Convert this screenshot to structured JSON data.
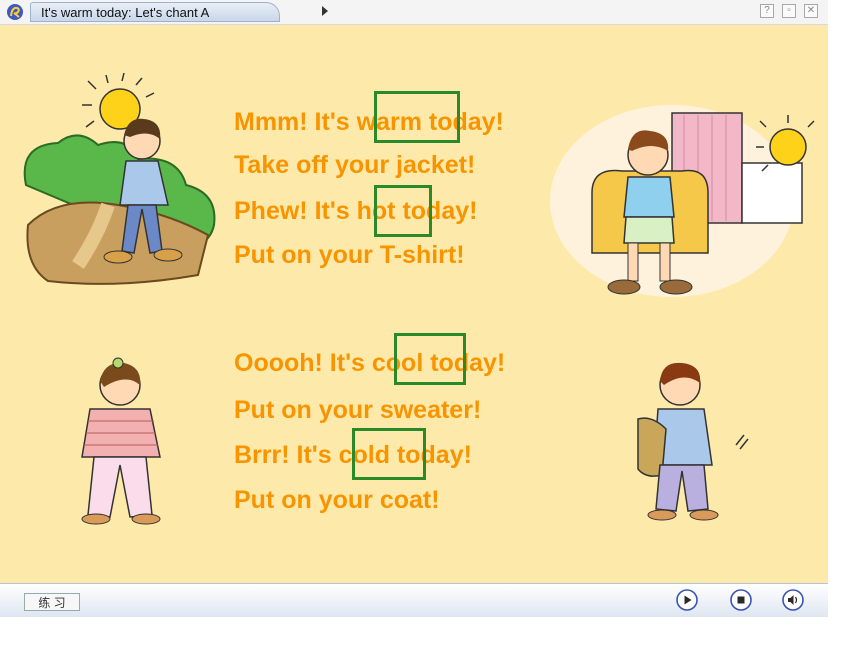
{
  "window": {
    "title": "It's warm today: Let's chant A",
    "help_label": "?",
    "restore_label": "▫",
    "close_label": "✕"
  },
  "chant": {
    "verse1": {
      "line1_a": "Mmm! It's ",
      "line1_word": "warm",
      "line1_b": " today!",
      "line2": "Take off your jacket!",
      "line3_a": "Phew! It's ",
      "line3_word": "hot",
      "line3_b": " today!",
      "line4": "Put on your T-shirt!"
    },
    "verse2": {
      "line1_a": "Ooooh! It's ",
      "line1_word": "cool",
      "line1_b": " today!",
      "line2": "Put on your sweater!",
      "line3_a": "Brrr! It's ",
      "line3_word": "cold",
      "line3_b": " today!",
      "line4": "Put on your coat!"
    }
  },
  "toolbar": {
    "practice_label": "练 习",
    "controls": [
      "play-icon",
      "stop-icon",
      "volume-icon"
    ]
  },
  "colors": {
    "slide_bg": "#fdeaaa",
    "text": "#f79400",
    "highlight_box": "#2a8a2a",
    "control_blue": "#3a52b0"
  }
}
